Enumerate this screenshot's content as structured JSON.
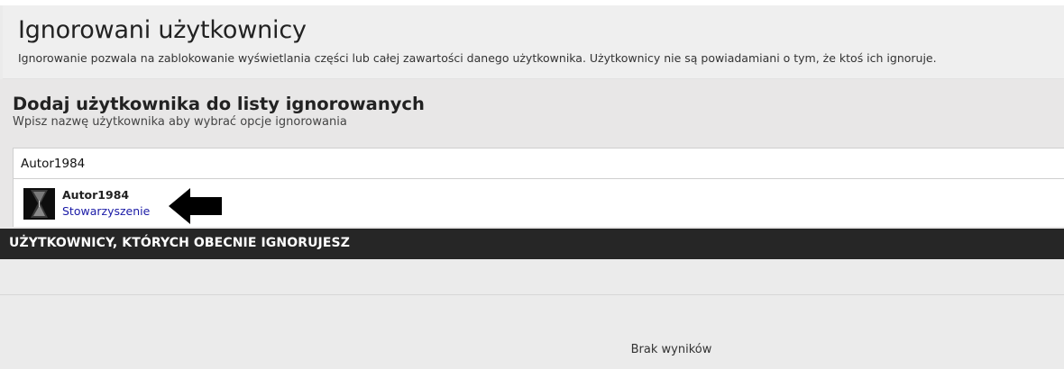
{
  "header": {
    "title": "Ignorowani użytkownicy",
    "description": "Ignorowanie pozwala na zablokowanie wyświetlania części lub całej zawartości danego użytkownika. Użytkownicy nie są powiadamiani o tym, że ktoś ich ignoruje."
  },
  "add_section": {
    "title": "Dodaj użytkownika do listy ignorowanych",
    "subtitle": "Wpisz nazwę użytkownika aby wybrać opcje ignorowania",
    "search_value": "Autor1984"
  },
  "suggestion": {
    "name": "Autor1984",
    "group": "Stowarzyszenie",
    "group_color": "#1a1aa6"
  },
  "ignored_section": {
    "title": "UŻYTKOWNICY, KTÓRYCH OBECNIE IGNORUJESZ",
    "empty_text": "Brak wyników"
  },
  "colors": {
    "dark_bar": "#262626",
    "background": "#ebebeb"
  }
}
